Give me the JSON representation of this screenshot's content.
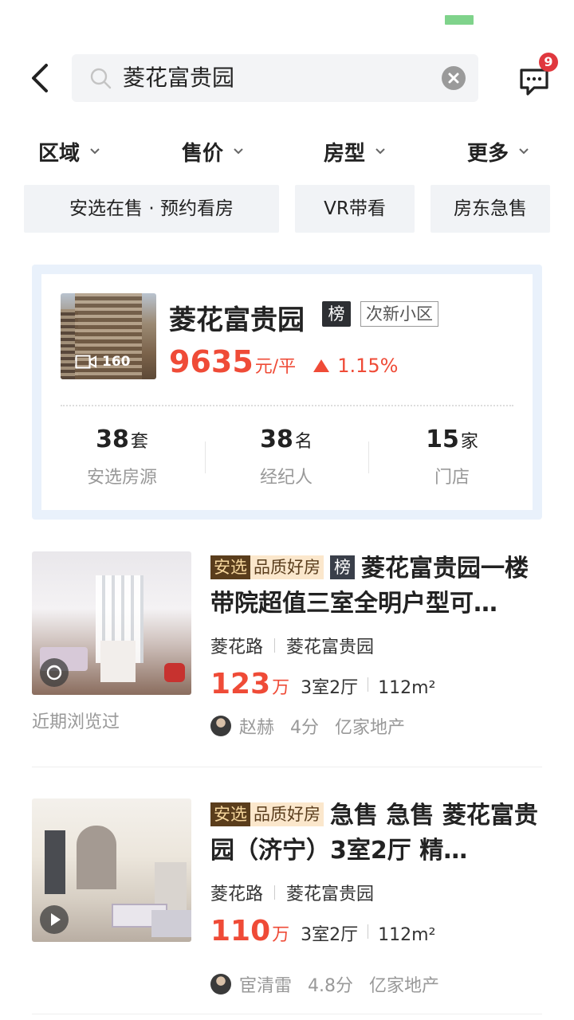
{
  "search": {
    "query": "菱花富贵园"
  },
  "header": {
    "message_badge": "9"
  },
  "filters": [
    {
      "label": "区域"
    },
    {
      "label": "售价"
    },
    {
      "label": "房型"
    },
    {
      "label": "更多"
    }
  ],
  "quick_tags": [
    {
      "label": "安选在售 · 预约看房"
    },
    {
      "label": "VR带看"
    },
    {
      "label": "房东急售"
    }
  ],
  "community": {
    "name": "菱花富贵园",
    "rank_badge": "榜",
    "category": "次新小区",
    "photo_count": "160",
    "price": "9635",
    "price_unit": "元/平",
    "change": "1.15%",
    "stats": [
      {
        "value": "38",
        "unit": "套",
        "label": "安选房源"
      },
      {
        "value": "38",
        "unit": "名",
        "label": "经纪人"
      },
      {
        "value": "15",
        "unit": "家",
        "label": "门店"
      }
    ]
  },
  "listings": [
    {
      "chip_anxuan": "安选",
      "chip_quality": "品质好房",
      "chip_rank": "榜",
      "title": "菱花富贵园一楼带院超值三室全明户型可…",
      "road": "菱花路",
      "community": "菱花富贵园",
      "price": "123",
      "price_unit": "万",
      "rooms": "3室2厅",
      "area": "112m²",
      "agent": "赵赫",
      "score": "4分",
      "company": "亿家地产",
      "seen": "近期浏览过"
    },
    {
      "chip_anxuan": "安选",
      "chip_quality": "品质好房",
      "title": "急售 急售 菱花富贵园（济宁）3室2厅 精…",
      "road": "菱花路",
      "community": "菱花富贵园",
      "price": "110",
      "price_unit": "万",
      "rooms": "3室2厅",
      "area": "112m²",
      "agent": "宦清雷",
      "score": "4.8分",
      "company": "亿家地产"
    }
  ],
  "colors": {
    "accent_red": "#ef4b37",
    "badge_red": "#e0383e",
    "card_bg": "#e9f1fb"
  }
}
